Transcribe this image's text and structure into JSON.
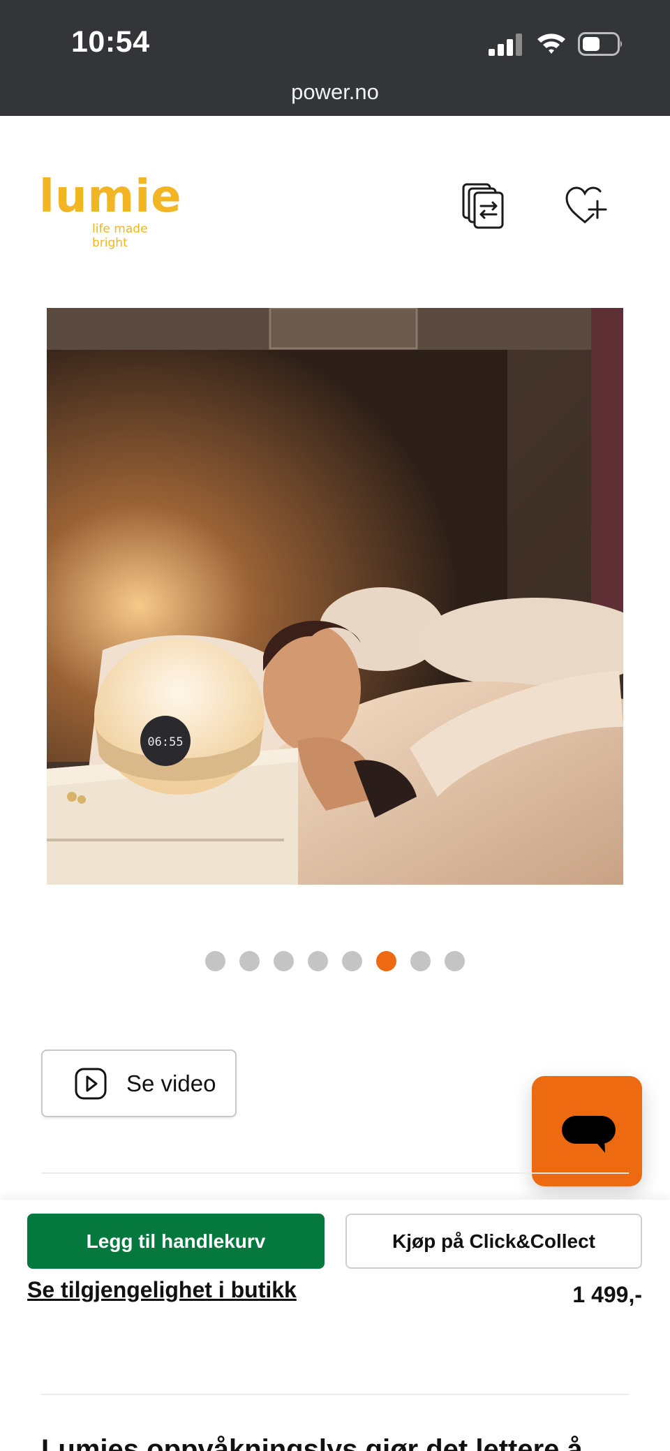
{
  "status_bar": {
    "time": "10:54",
    "url": "power.no"
  },
  "header": {
    "logo_word": "lumie",
    "logo_tagline": "life made bright",
    "compare_icon": "compare-icon",
    "wishlist_icon": "heart-plus-icon"
  },
  "gallery": {
    "image_alt": "Woman in bed next to Lumie wake-up light showing 06:55",
    "clock_display": "06:55",
    "dot_count": 8,
    "active_dot": 6
  },
  "video": {
    "label": "Se video",
    "icon": "play-icon"
  },
  "chat": {
    "icon": "chat-bubble-icon",
    "color": "#ee6a10"
  },
  "purchase": {
    "add_to_cart": "Legg til handlekurv",
    "click_collect": "Kjøp på Click&Collect",
    "store_availability": "Se tilgjengelighet i butikk",
    "price": "1 499,-",
    "primary_color": "#05783d"
  },
  "description": {
    "title": "Lumies oppvåkningslys gjør det lettere å"
  }
}
